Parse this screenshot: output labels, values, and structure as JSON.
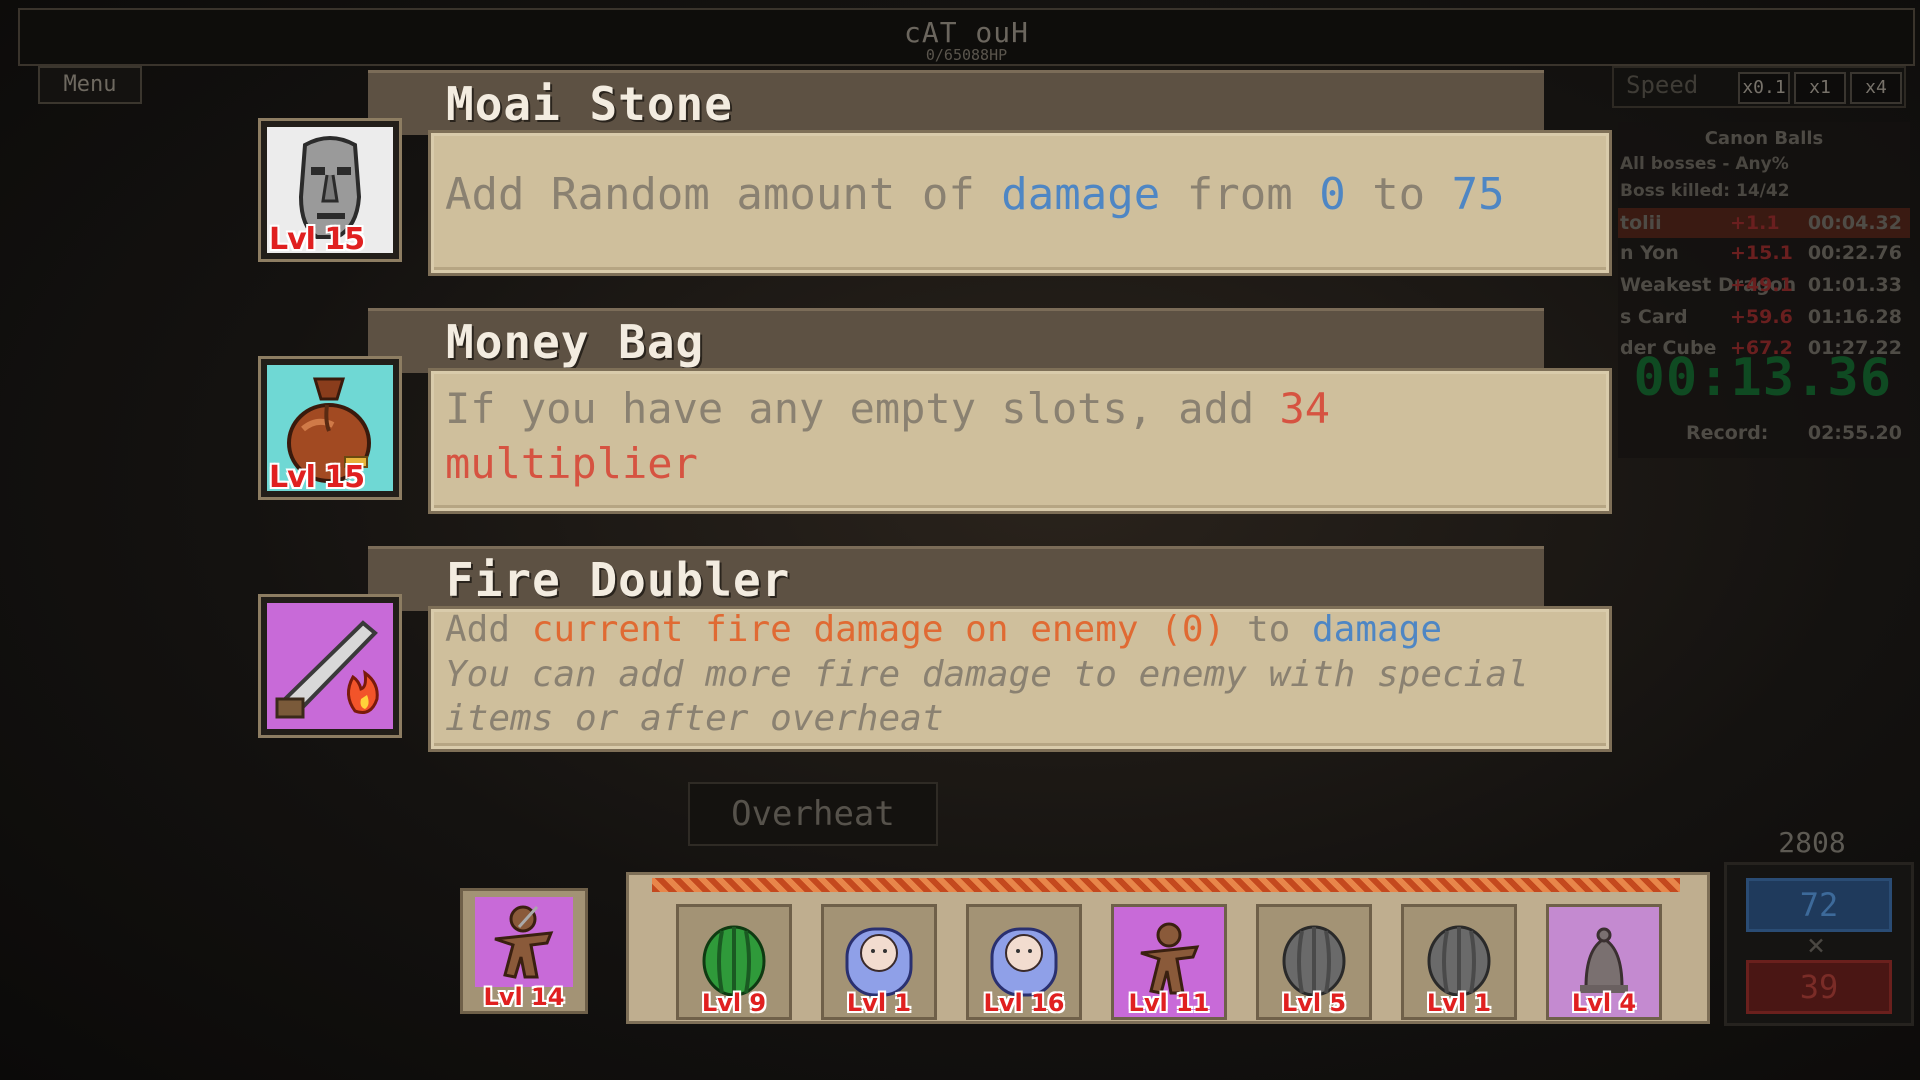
{
  "boss": {
    "name": "cAT ouH",
    "hp": "0/65088HP"
  },
  "menu_label": "Menu",
  "speed": {
    "label": "Speed",
    "options": [
      "x0.1",
      "x1",
      "x4"
    ]
  },
  "splits": {
    "title": "Canon Balls",
    "category": "All bosses - Any%",
    "progress": "Boss killed: 14/42",
    "rows": [
      {
        "name": "tolii",
        "delta": "+1.1",
        "time": "00:04.32"
      },
      {
        "name": "n Yon",
        "delta": "+15.1",
        "time": "00:22.76"
      },
      {
        "name": "Weakest Dragon",
        "delta": "+49.1",
        "time": "01:01.33"
      },
      {
        "name": "s Card",
        "delta": "+59.6",
        "time": "01:16.28"
      },
      {
        "name": "der Cube",
        "delta": "+67.2",
        "time": "01:27.22"
      }
    ],
    "timer": "00:13.36",
    "record_label": "Record:",
    "record_time": "02:55.20"
  },
  "items": [
    {
      "title": "Moai Stone",
      "level": "Lvl 15",
      "icon": "moai-icon",
      "text_parts": [
        {
          "t": "Add Random amount of ",
          "c": ""
        },
        {
          "t": "damage",
          "c": "hl-blue"
        },
        {
          "t": " from ",
          "c": ""
        },
        {
          "t": "0",
          "c": "hl-blue"
        },
        {
          "t": " to ",
          "c": ""
        },
        {
          "t": "75",
          "c": "hl-blue"
        }
      ]
    },
    {
      "title": "Money Bag",
      "level": "Lvl 15",
      "icon": "money-bag-icon",
      "text_parts": [
        {
          "t": "If you have any empty slots, add ",
          "c": ""
        },
        {
          "t": "34 multiplier",
          "c": "hl-red"
        }
      ]
    },
    {
      "title": "Fire Doubler",
      "level": "",
      "icon": "flamethrower-icon",
      "line1": [
        {
          "t": "Add ",
          "c": ""
        },
        {
          "t": "current fire damage on enemy (0)",
          "c": "hl-orange"
        },
        {
          "t": " to ",
          "c": ""
        },
        {
          "t": "damage",
          "c": "hl-blue"
        }
      ],
      "line2": "You can add more fire damage to enemy with special items or after overheat"
    }
  ],
  "overheat_label": "Overheat",
  "held_item": {
    "level": "Lvl 14",
    "icon": "voodoo-doll-icon"
  },
  "inventory": [
    {
      "level": "Lvl 9",
      "icon": "watermelon-icon"
    },
    {
      "level": "Lvl 1",
      "icon": "baby-icon"
    },
    {
      "level": "Lvl 16",
      "icon": "baby-icon"
    },
    {
      "level": "Lvl 11",
      "icon": "voodoo-doll-icon"
    },
    {
      "level": "Lvl 5",
      "icon": "cannonball-icon"
    },
    {
      "level": "Lvl 1",
      "icon": "cannonball-icon"
    },
    {
      "level": "Lvl 4",
      "icon": "bell-icon"
    }
  ],
  "score": {
    "total": "2808",
    "damage": "72",
    "times": "×",
    "multiplier": "39"
  },
  "colors": {
    "card_bg": "#cfbf9c",
    "header_bg": "#5d5143",
    "blue": "#4e86c4",
    "red": "#d65341",
    "orange": "#e06a33",
    "timer_green": "#0f4a22"
  }
}
